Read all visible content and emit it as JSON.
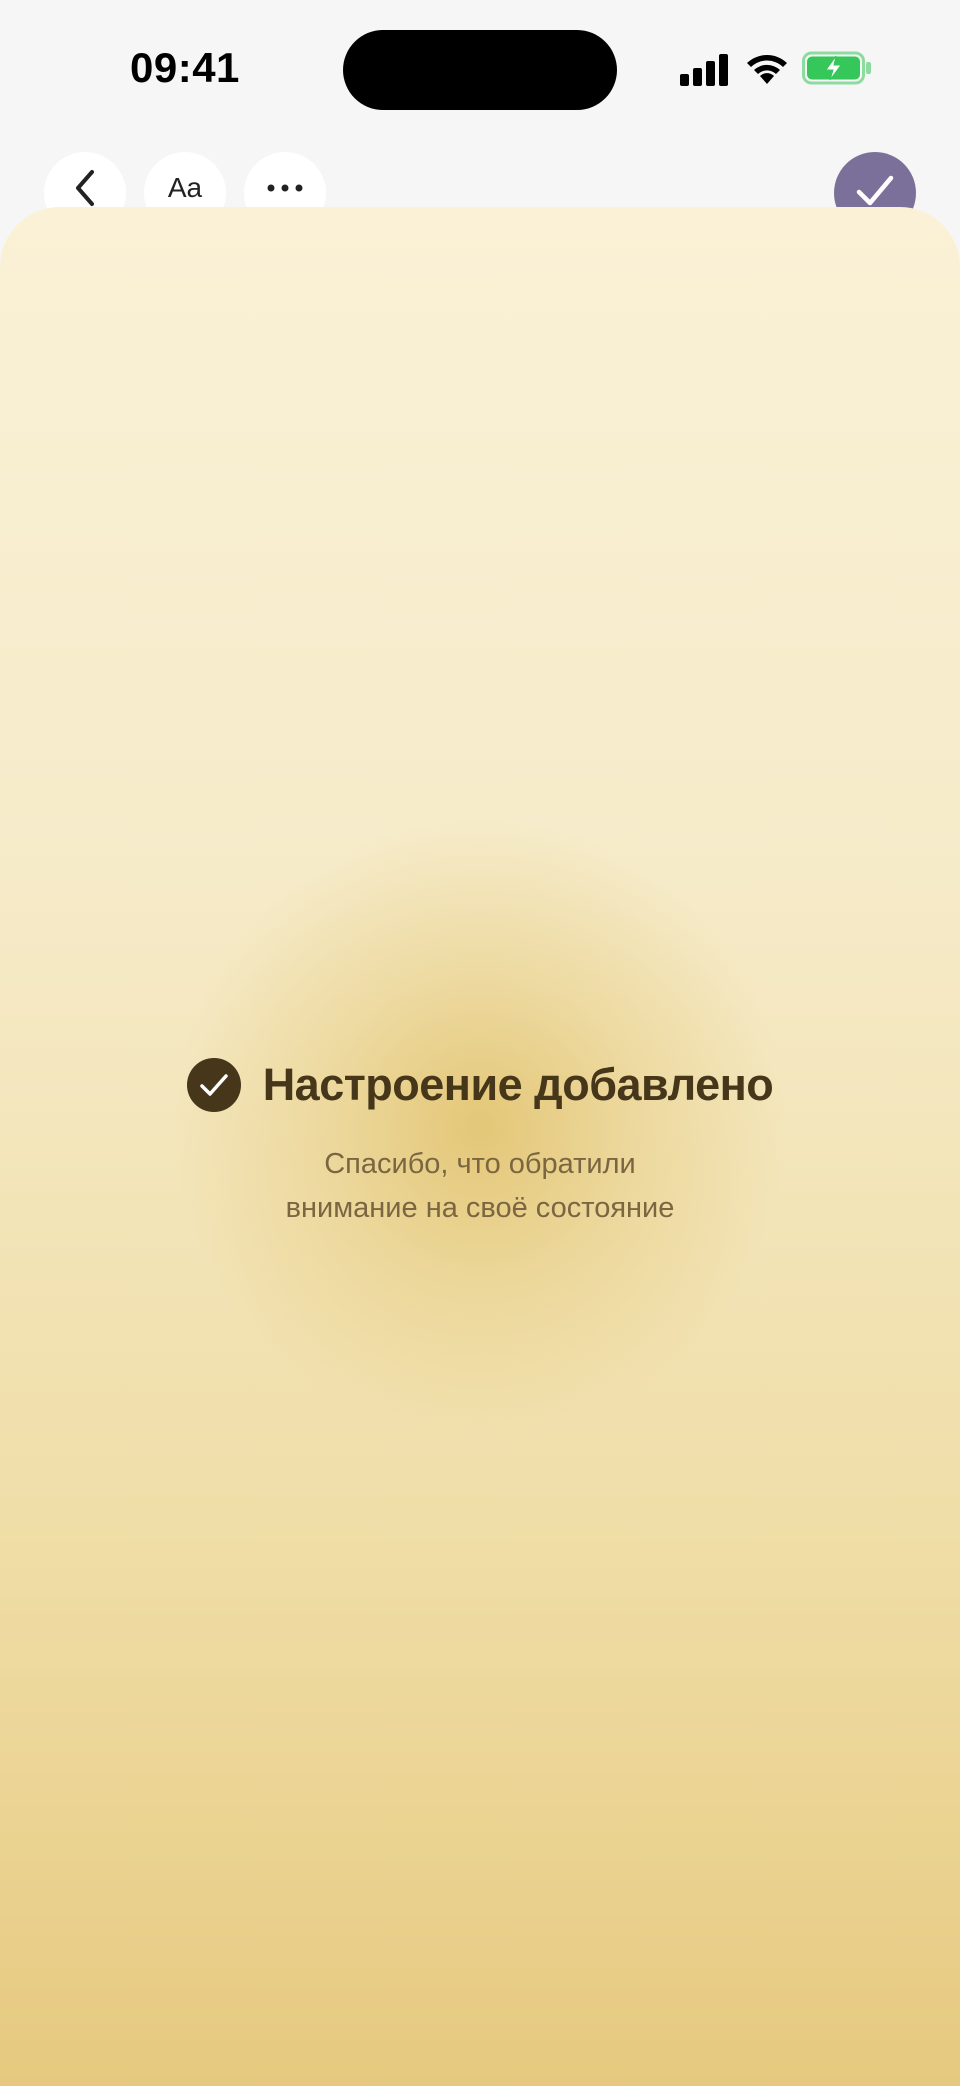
{
  "status_bar": {
    "time": "09:41",
    "icons": [
      "cellular-signal-icon",
      "wifi-icon",
      "battery-charging-icon"
    ]
  },
  "toolbar": {
    "back_icon": "chevron-left-icon",
    "font_label": "Aa",
    "more_icon": "ellipsis-icon",
    "confirm_icon": "checkmark-icon"
  },
  "result": {
    "title": "Настроение добавлено",
    "subtitle_line1": "Спасибо, что обратили",
    "subtitle_line2": "внимание на своё состояние"
  },
  "colors": {
    "accent": "#7b7099",
    "title_text": "#46361a",
    "subtitle_text": "#7a6640",
    "battery_green": "#35c759"
  }
}
